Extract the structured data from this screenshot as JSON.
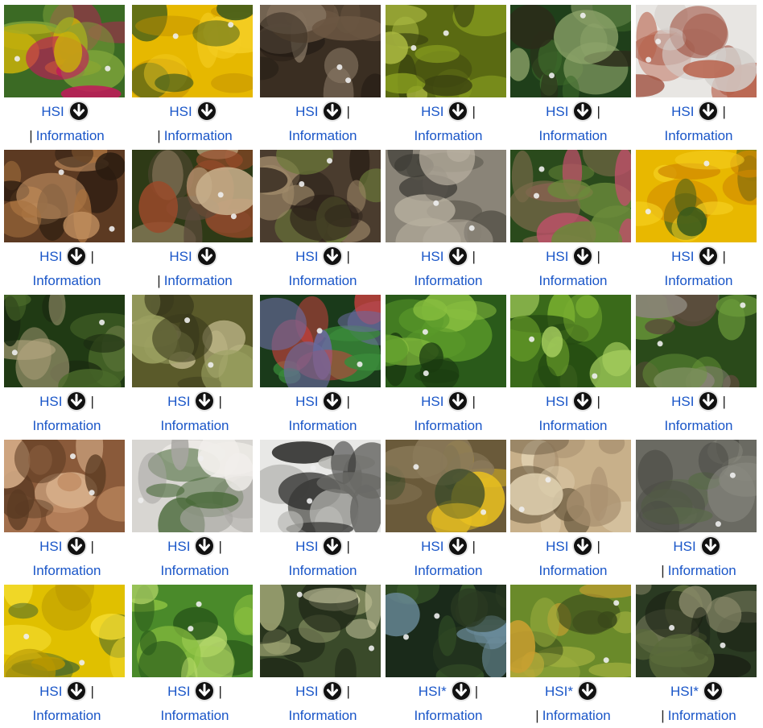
{
  "gallery": {
    "download_icon": "download-arrow-icon",
    "separator": "|",
    "items": [
      {
        "hsi": "HSI",
        "info": "Information",
        "lead_sep": false,
        "trail_sep": false,
        "info_sep": true,
        "palette": [
          "#3b6a24",
          "#c9b20a",
          "#c01a5a",
          "#7da33a"
        ]
      },
      {
        "hsi": "HSI",
        "info": "Information",
        "lead_sep": false,
        "trail_sep": false,
        "info_sep": true,
        "palette": [
          "#e6b800",
          "#f4cd22",
          "#3d5a1b",
          "#c08f00"
        ]
      },
      {
        "hsi": "HSI",
        "info": "Information",
        "lead_sep": false,
        "trail_sep": true,
        "info_sep": false,
        "palette": [
          "#3a2e22",
          "#6b5642",
          "#8a7966",
          "#241c14"
        ]
      },
      {
        "hsi": "HSI",
        "info": "Information",
        "lead_sep": false,
        "trail_sep": true,
        "info_sep": false,
        "palette": [
          "#5a6a12",
          "#8aa020",
          "#3c4510",
          "#a9b640"
        ]
      },
      {
        "hsi": "HSI",
        "info": "Information",
        "lead_sep": false,
        "trail_sep": true,
        "info_sep": false,
        "palette": [
          "#1f3f1a",
          "#3e6b2c",
          "#8ea46a",
          "#2b2b1a"
        ]
      },
      {
        "hsi": "HSI",
        "info": "Information",
        "lead_sep": false,
        "trail_sep": true,
        "info_sep": false,
        "palette": [
          "#e8e6e3",
          "#9c4a38",
          "#b8604a",
          "#d4d0cc"
        ]
      },
      {
        "hsi": "HSI",
        "info": "Information",
        "lead_sep": false,
        "trail_sep": true,
        "info_sep": false,
        "palette": [
          "#5c3a22",
          "#a6703e",
          "#2a1b10",
          "#c49262"
        ]
      },
      {
        "hsi": "HSI",
        "info": "Information",
        "lead_sep": false,
        "trail_sep": false,
        "info_sep": true,
        "palette": [
          "#2e3a16",
          "#9a4a2a",
          "#c9b08c",
          "#5a4a3a"
        ]
      },
      {
        "hsi": "HSI",
        "info": "Information",
        "lead_sep": false,
        "trail_sep": true,
        "info_sep": false,
        "palette": [
          "#4a3c2e",
          "#a08a6a",
          "#2a2018",
          "#6c7a3a"
        ]
      },
      {
        "hsi": "HSI",
        "info": "Information",
        "lead_sep": false,
        "trail_sep": true,
        "info_sep": false,
        "palette": [
          "#8a8478",
          "#5a564c",
          "#b8b0a0",
          "#3c3a34"
        ]
      },
      {
        "hsi": "HSI",
        "info": "Information",
        "lead_sep": false,
        "trail_sep": true,
        "info_sep": false,
        "palette": [
          "#2a4a1c",
          "#c0506a",
          "#6a8a3a",
          "#7a6a4a"
        ]
      },
      {
        "hsi": "HSI",
        "info": "Information",
        "lead_sep": false,
        "trail_sep": true,
        "info_sep": false,
        "palette": [
          "#e8b800",
          "#f5d020",
          "#3a5a1a",
          "#d08800"
        ]
      },
      {
        "hsi": "HSI",
        "info": "Information",
        "lead_sep": false,
        "trail_sep": true,
        "info_sep": false,
        "palette": [
          "#203a14",
          "#4a6a2a",
          "#b4a680",
          "#1a2a10"
        ]
      },
      {
        "hsi": "HSI",
        "info": "Information",
        "lead_sep": false,
        "trail_sep": true,
        "info_sep": false,
        "palette": [
          "#5a5a2a",
          "#9aa060",
          "#3a3a1c",
          "#c0b88a"
        ]
      },
      {
        "hsi": "HSI",
        "info": "Information",
        "lead_sep": false,
        "trail_sep": true,
        "info_sep": false,
        "palette": [
          "#1a3a1a",
          "#3a8a3a",
          "#6a6aa0",
          "#d04040"
        ]
      },
      {
        "hsi": "HSI",
        "info": "Information",
        "lead_sep": false,
        "trail_sep": true,
        "info_sep": false,
        "palette": [
          "#2a5a1a",
          "#5a9a2a",
          "#8ac040",
          "#1a3a10"
        ]
      },
      {
        "hsi": "HSI",
        "info": "Information",
        "lead_sep": false,
        "trail_sep": true,
        "info_sep": false,
        "palette": [
          "#3a6a1a",
          "#7ab030",
          "#a8d060",
          "#244a12"
        ]
      },
      {
        "hsi": "HSI",
        "info": "Information",
        "lead_sep": false,
        "trail_sep": true,
        "info_sep": false,
        "palette": [
          "#2a4a1a",
          "#5a4a3a",
          "#6a9a3a",
          "#8a8478"
        ]
      },
      {
        "hsi": "HSI",
        "info": "Information",
        "lead_sep": false,
        "trail_sep": true,
        "info_sep": false,
        "palette": [
          "#8a5a3a",
          "#c08a62",
          "#5a3a22",
          "#d8b08a"
        ]
      },
      {
        "hsi": "HSI",
        "info": "Information",
        "lead_sep": false,
        "trail_sep": true,
        "info_sep": false,
        "palette": [
          "#d8d6d2",
          "#a8a6a2",
          "#4a6a3a",
          "#f0eeea"
        ]
      },
      {
        "hsi": "HSI",
        "info": "Information",
        "lead_sep": false,
        "trail_sep": true,
        "info_sep": false,
        "palette": [
          "#e8e8e6",
          "#2a2a28",
          "#b8b8b4",
          "#6a6a66"
        ]
      },
      {
        "hsi": "HSI",
        "info": "Information",
        "lead_sep": false,
        "trail_sep": true,
        "info_sep": false,
        "palette": [
          "#6a5a3a",
          "#e8c020",
          "#8a7a5a",
          "#3a4a2a"
        ]
      },
      {
        "hsi": "HSI",
        "info": "Information",
        "lead_sep": false,
        "trail_sep": true,
        "info_sep": false,
        "palette": [
          "#c8b08a",
          "#a89070",
          "#e0d0b0",
          "#6a5a40"
        ]
      },
      {
        "hsi": "HSI",
        "info": "Information",
        "lead_sep": false,
        "trail_sep": false,
        "info_sep": true,
        "palette": [
          "#6a6a62",
          "#8a8a80",
          "#4a4a44",
          "#5a6a4a"
        ]
      },
      {
        "hsi": "HSI",
        "info": "Information",
        "lead_sep": false,
        "trail_sep": true,
        "info_sep": false,
        "palette": [
          "#e0c000",
          "#f4dc30",
          "#4a6a2a",
          "#b89800"
        ]
      },
      {
        "hsi": "HSI",
        "info": "Information",
        "lead_sep": false,
        "trail_sep": true,
        "info_sep": false,
        "palette": [
          "#4a8a2a",
          "#8ac040",
          "#2a5a1a",
          "#c0e070"
        ]
      },
      {
        "hsi": "HSI",
        "info": "Information",
        "lead_sep": false,
        "trail_sep": true,
        "info_sep": false,
        "palette": [
          "#3a4a2a",
          "#9aa070",
          "#1c2414",
          "#c8c8a0"
        ]
      },
      {
        "hsi": "HSI*",
        "info": "Information",
        "lead_sep": false,
        "trail_sep": true,
        "info_sep": false,
        "palette": [
          "#1a2a1a",
          "#3a5a2a",
          "#6a8a9a",
          "#2a3a22"
        ]
      },
      {
        "hsi": "HSI*",
        "info": "Information",
        "lead_sep": false,
        "trail_sep": false,
        "info_sep": true,
        "palette": [
          "#6a8a2a",
          "#a0b040",
          "#c8a030",
          "#3a4a1a"
        ]
      },
      {
        "hsi": "HSI*",
        "info": "Information",
        "lead_sep": false,
        "trail_sep": false,
        "info_sep": true,
        "palette": [
          "#2a3a22",
          "#5a6a3a",
          "#8a8a6a",
          "#1a2014"
        ]
      }
    ]
  }
}
